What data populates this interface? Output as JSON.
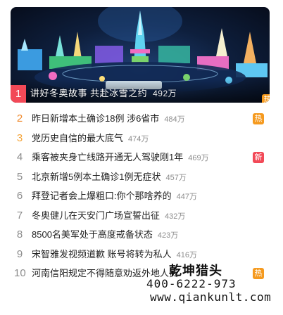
{
  "featured": {
    "rank": "1",
    "title": "讲好冬奥故事 共赴冰雪之约",
    "count": "492万",
    "badge": "热"
  },
  "items": [
    {
      "rank": "2",
      "title": "昨日新增本土确诊18例 涉6省市",
      "count": "484万",
      "badge": "热",
      "badge_type": "hot"
    },
    {
      "rank": "3",
      "title": "党历史自信的最大底气",
      "count": "474万",
      "badge": "",
      "badge_type": ""
    },
    {
      "rank": "4",
      "title": "乘客被夹身亡线路开通无人驾驶刚1年",
      "count": "469万",
      "badge": "新",
      "badge_type": "new"
    },
    {
      "rank": "5",
      "title": "北京新增5例本土确诊1例无症状",
      "count": "457万",
      "badge": "",
      "badge_type": ""
    },
    {
      "rank": "6",
      "title": "拜登记者会上爆粗口:你个那啥养的",
      "count": "447万",
      "badge": "",
      "badge_type": ""
    },
    {
      "rank": "7",
      "title": "冬奥健儿在天安门广场宣誓出征",
      "count": "432万",
      "badge": "",
      "badge_type": ""
    },
    {
      "rank": "8",
      "title": "8500名美军处于高度戒备状态",
      "count": "423万",
      "badge": "",
      "badge_type": ""
    },
    {
      "rank": "9",
      "title": "宋智雅发视频道歉 账号将转为私人",
      "count": "416万",
      "badge": "",
      "badge_type": ""
    },
    {
      "rank": "10",
      "title": "河南信阳规定不得随意劝返外地人员",
      "count": "",
      "badge": "热",
      "badge_type": "hot"
    }
  ],
  "watermark": {
    "name": "乾坤猎头",
    "phone": "400-6222-973",
    "url": "www.qiankunlt.com"
  },
  "colors": {
    "rank_top": "#f0892b",
    "rank_normal": "#8c8c8c",
    "badge_hot": "#f59a1f",
    "badge_new": "#f24957"
  },
  "icons": {
    "banner_image": "ice-and-snow-festival-photo"
  }
}
